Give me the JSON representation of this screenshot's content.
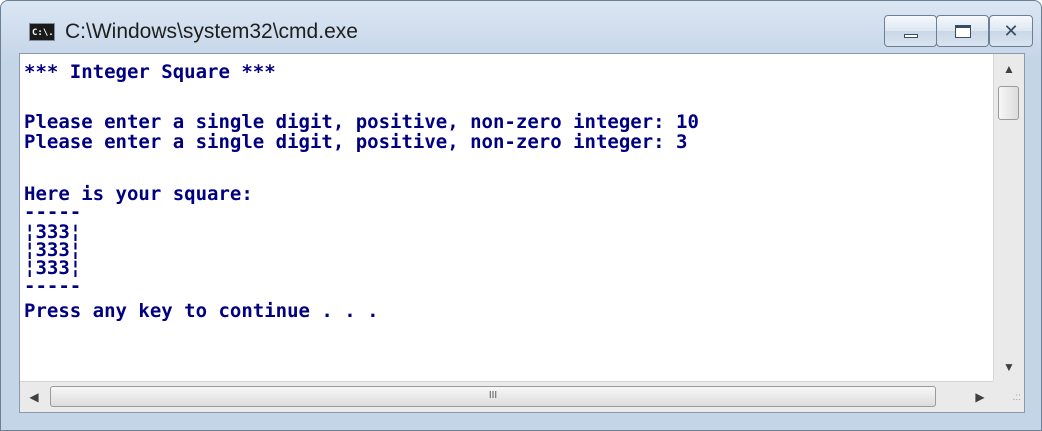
{
  "window": {
    "title": "C:\\Windows\\system32\\cmd.exe",
    "icon_label": "C:\\."
  },
  "console": {
    "lines": [
      "*** Integer Square ***",
      "",
      "Please enter a single digit, positive, non-zero integer: 10",
      "Please enter a single digit, positive, non-zero integer: 3",
      "",
      "Here is your square:",
      "-----",
      "¦333¦",
      "¦333¦",
      "¦333¦",
      "-----",
      "Press any key to continue . . ."
    ],
    "text_color": "#000080",
    "background": "#ffffff"
  },
  "scrollbars": {
    "vertical_up": "▲",
    "vertical_down": "▼",
    "horizontal_left": "◀",
    "horizontal_right": "▶",
    "horizontal_grip": "III",
    "size_grip": ".::"
  }
}
